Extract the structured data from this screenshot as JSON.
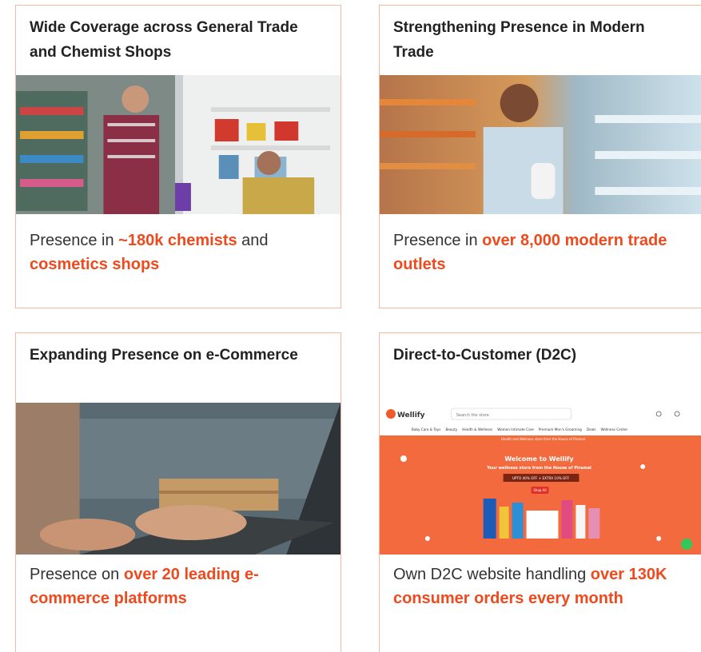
{
  "cards": [
    {
      "title": "Wide Coverage across General Trade and Chemist Shops",
      "desc_pre": "Presence in ",
      "desc_hl1": "~180k chemists",
      "desc_mid": " and ",
      "desc_hl2": "cosmetics shops"
    },
    {
      "title": "Strengthening Presence in Modern Trade",
      "desc_pre": "Presence in ",
      "desc_hl1": "over 8,000 modern trade outlets"
    },
    {
      "title": "Expanding Presence on e-Commerce",
      "desc_pre": "Presence on ",
      "desc_hl1": "over 20 leading e-commerce platforms"
    },
    {
      "title": "Direct-to-Customer (D2C)",
      "desc_pre": "Own D2C website handling ",
      "desc_hl1": "over 130K consumer orders every month"
    }
  ],
  "website_screenshot": {
    "logo": "Wellify",
    "search_placeholder": "Search the store",
    "nav_items": [
      "Baby Care & Toys",
      "Beauty",
      "Health & Wellness",
      "Women Intimate Care",
      "Premium Men's Grooming",
      "Deals",
      "Wellness Center"
    ],
    "strip_text": "Health and Wellness store from the House of Piramal",
    "banner_title": "Welcome to Wellify",
    "banner_subtitle": "Your wellness store from the House of Piramal",
    "offer_text": "UPTO 40% OFF + EXTRA 10% OFF",
    "cta_label": "Shop All"
  },
  "colors": {
    "accent": "#ee4a1e",
    "card_border": "#f6b89e",
    "text": "#333333"
  }
}
